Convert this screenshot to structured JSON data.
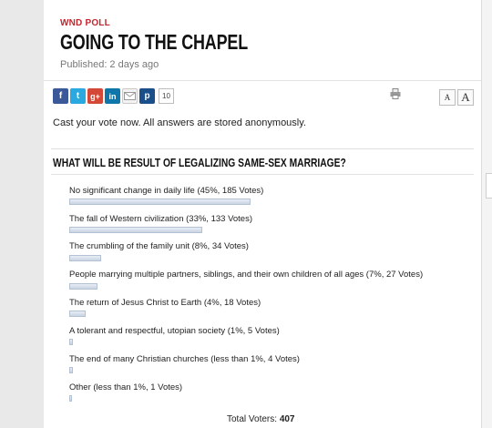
{
  "article": {
    "kicker": "WND POLL",
    "title": "GOING TO THE CHAPEL",
    "published": "Published: 2 days ago"
  },
  "share": {
    "icons": [
      "facebook-icon",
      "twitter-icon",
      "google-plus-icon",
      "linkedin-icon",
      "email-icon",
      "pocket-icon"
    ],
    "count": "10",
    "print_icon": "printer-icon",
    "font_small": "A",
    "font_large": "A"
  },
  "poll": {
    "intro": "Cast your vote now. All answers are stored anonymously.",
    "question": "WHAT WILL BE RESULT OF LEGALIZING SAME-SEX MARRIAGE?",
    "options": [
      {
        "label": "No significant change in daily life (45%, 185 Votes)",
        "percent": 45
      },
      {
        "label": "The fall of Western civilization (33%, 133 Votes)",
        "percent": 33
      },
      {
        "label": "The crumbling of the family unit (8%, 34 Votes)",
        "percent": 8
      },
      {
        "label": "People marrying multiple partners, siblings, and their own children of all ages (7%, 27 Votes)",
        "percent": 7
      },
      {
        "label": "The return of Jesus Christ to Earth (4%, 18 Votes)",
        "percent": 4
      },
      {
        "label": "A tolerant and respectful, utopian society (1%, 5 Votes)",
        "percent": 1
      },
      {
        "label": "The end of many Christian churches (less than 1%, 4 Votes)",
        "percent": 1
      },
      {
        "label": "Other (less than 1%, 1 Votes)",
        "percent": 0.25
      }
    ],
    "total_label": "Total Voters:",
    "total_value": "407"
  },
  "colors": {
    "kicker": "#c4262e",
    "bar": "#d3dce9"
  }
}
